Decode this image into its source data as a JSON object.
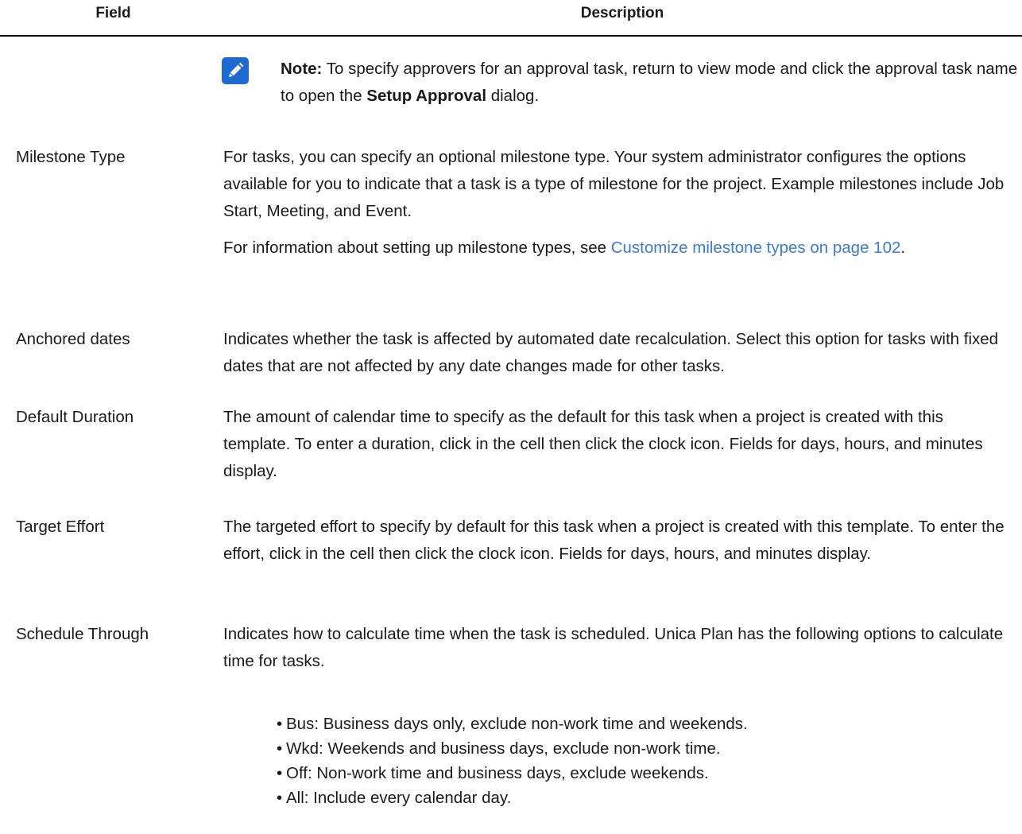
{
  "header": {
    "field": "Field",
    "description": "Description"
  },
  "note": {
    "icon": "pencil-note-icon",
    "icon_color": "#1f6ad0",
    "label": "Note:",
    "text_before": " To specify approvers for an approval task, return to view mode and click the approval task name to open the ",
    "bold_term": "Setup Approval",
    "text_after": " dialog."
  },
  "rows": [
    {
      "field": "Milestone Type",
      "description": "For tasks, you can specify an optional milestone type. Your system administrator configures the options available for you to indicate that a task is a type of milestone for the project. Example milestones include Job Start, Meeting, and Event.",
      "extra_before": "For information about setting up milestone types, see ",
      "extra_link": "Customize milestone types on page 102",
      "extra_after": "."
    },
    {
      "field": "Anchored dates",
      "description": "Indicates whether the task is affected by automated date recalculation. Select this option for tasks with fixed dates that are not affected by any date changes made for other tasks."
    },
    {
      "field": "Default Duration",
      "description": "The amount of calendar time to specify as the default for this task when a project is created with this template. To enter a duration, click in the cell then click the clock icon. Fields for days, hours, and minutes display."
    },
    {
      "field": "Target Effort",
      "description": "The targeted effort to specify by default for this task when a project is created with this template. To enter the effort, click in the cell then click the clock icon. Fields for days, hours, and minutes display."
    },
    {
      "field": "Schedule Through",
      "description": "Indicates how to calculate time when the task is scheduled. Unica Plan has the following options to calculate time for tasks."
    }
  ],
  "schedule_options": [
    "Bus: Business days only, exclude non-work time and weekends.",
    "Wkd: Weekends and business days, exclude non-work time.",
    "Off: Non-work time and business days, exclude weekends.",
    "All: Include every calendar day."
  ]
}
